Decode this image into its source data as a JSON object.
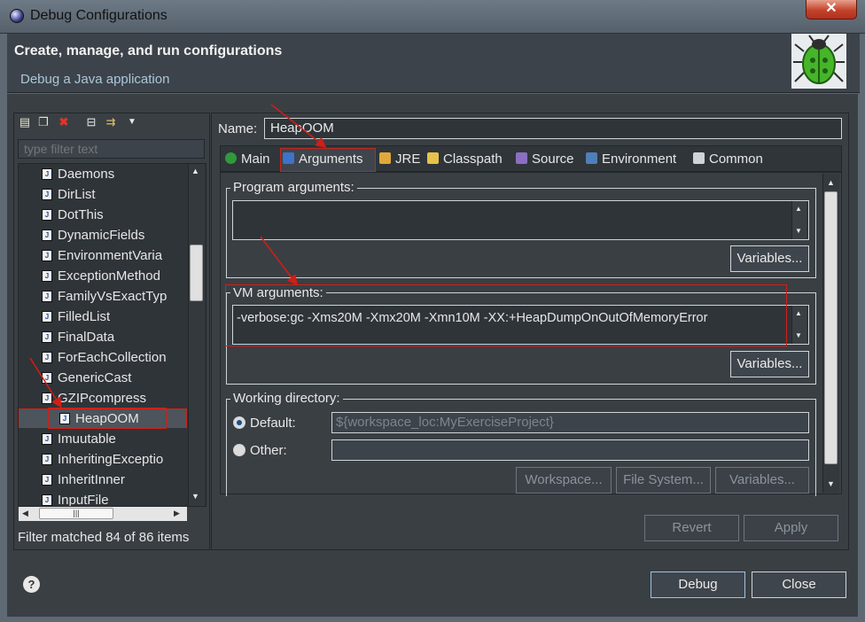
{
  "window": {
    "title": "Debug Configurations",
    "close_glyph": "✕"
  },
  "header": {
    "title": "Create, manage, and run configurations",
    "subtitle": "Debug a Java application",
    "icon": "bug-icon"
  },
  "toolbar": {
    "icons": [
      "new-config-icon",
      "duplicate-icon",
      "delete-icon",
      "collapse-all-icon",
      "filter-icon",
      "dropdown-arrow-icon"
    ]
  },
  "filter": {
    "placeholder": "type filter text"
  },
  "tree": {
    "items": [
      "Daemons",
      "DirList",
      "DotThis",
      "DynamicFields",
      "EnvironmentVaria",
      "ExceptionMethod",
      "FamilyVsExactTyp",
      "FilledList",
      "FinalData",
      "ForEachCollection",
      "GenericCast",
      "GZIPcompress",
      "HeapOOM",
      "Imuutable",
      "InheritingExceptio",
      "InheritInner",
      "InputFile"
    ],
    "selected": "HeapOOM",
    "icon_glyph": "J"
  },
  "filter_status": "Filter matched 84 of 86 items",
  "name": {
    "label": "Name:",
    "value": "HeapOOM"
  },
  "tabs": [
    {
      "label": "Main",
      "icon": "main-class-icon"
    },
    {
      "label": "Arguments",
      "icon": "arguments-icon"
    },
    {
      "label": "JRE",
      "icon": "jre-icon"
    },
    {
      "label": "Classpath",
      "icon": "classpath-icon"
    },
    {
      "label": "Source",
      "icon": "source-icon"
    },
    {
      "label": "Environment",
      "icon": "environment-icon"
    },
    {
      "label": "Common",
      "icon": "common-icon"
    }
  ],
  "active_tab": "Arguments",
  "program_args": {
    "label": "Program arguments:",
    "value": "",
    "variables_button": "Variables..."
  },
  "vm_args": {
    "label": "VM arguments:",
    "value": "-verbose:gc -Xms20M -Xmx20M -Xmn10M -XX:+HeapDumpOnOutOfMemoryError",
    "variables_button": "Variables..."
  },
  "working_dir": {
    "label": "Working directory:",
    "default_label": "Default:",
    "default_value": "${workspace_loc:MyExerciseProject}",
    "other_label": "Other:",
    "other_value": "",
    "selected": "Default",
    "buttons": [
      "Workspace...",
      "File System...",
      "Variables..."
    ]
  },
  "actions": {
    "revert": "Revert",
    "apply": "Apply"
  },
  "footer": {
    "debug": "Debug",
    "close": "Close",
    "help_icon": "help-icon",
    "help_glyph": "?"
  },
  "colors": {
    "annotation_red": "#d01f16",
    "background": "#3a3f44",
    "accent_blue": "#a9c7dc"
  }
}
